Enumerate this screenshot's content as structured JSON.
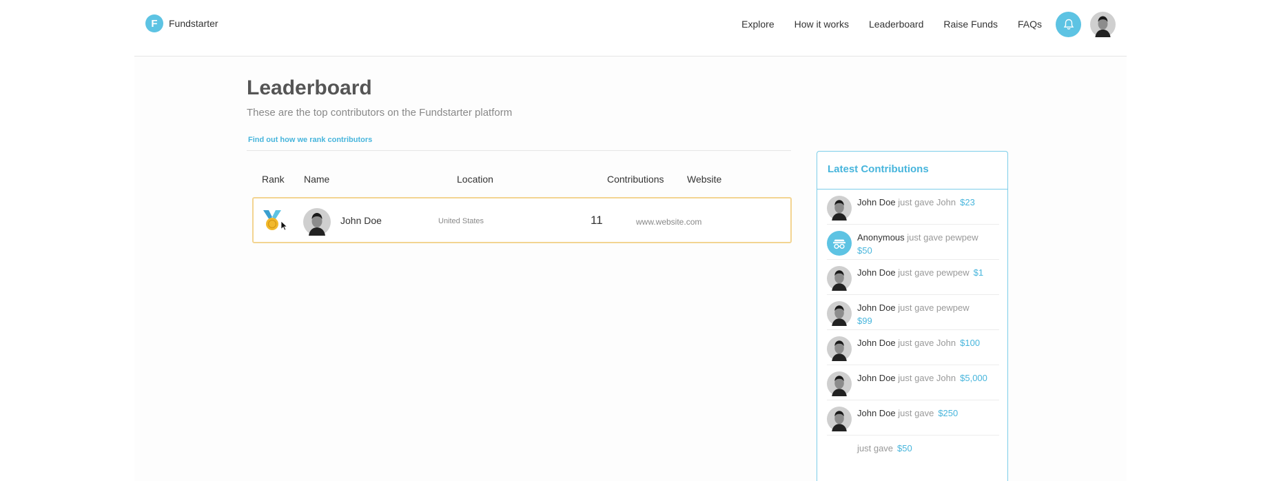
{
  "brand": {
    "logo_letter": "F",
    "name": "Fundstarter"
  },
  "nav": {
    "links": [
      "Explore",
      "How it works",
      "Leaderboard",
      "Raise Funds",
      "FAQs"
    ]
  },
  "page": {
    "title": "Leaderboard",
    "subtitle": "These are the top contributors on the Fundstarter platform",
    "rank_link": "Find out how we rank contributors"
  },
  "table": {
    "headers": {
      "rank": "Rank",
      "name": "Name",
      "location": "Location",
      "contributions": "Contributions",
      "website": "Website"
    },
    "rows": [
      {
        "rank_icon": "gold-medal-icon",
        "name": "John Doe",
        "location": "United States",
        "contributions": "11",
        "website": "www.website.com"
      }
    ]
  },
  "feed": {
    "title": "Latest Contributions",
    "items": [
      {
        "name": "John Doe",
        "action": "just gave John",
        "amount": "$23",
        "avatar": "user-photo"
      },
      {
        "name": "Anonymous",
        "action": "just gave pewpew",
        "amount": "$50",
        "avatar": "anonymous-icon"
      },
      {
        "name": "John Doe",
        "action": "just gave pewpew",
        "amount": "$1",
        "avatar": "user-photo"
      },
      {
        "name": "John Doe",
        "action": "just gave pewpew",
        "amount": "$99",
        "avatar": "user-photo"
      },
      {
        "name": "John Doe",
        "action": "just gave John",
        "amount": "$100",
        "avatar": "user-photo"
      },
      {
        "name": "John Doe",
        "action": "just gave John",
        "amount": "$5,000",
        "avatar": "user-photo"
      },
      {
        "name": "John Doe",
        "action": "just gave",
        "amount": "$250",
        "avatar": "user-photo"
      },
      {
        "name": "",
        "action": "just gave",
        "amount": "$50",
        "avatar": ""
      }
    ]
  },
  "colors": {
    "accent": "#5dc3e3",
    "link": "#47b5dc",
    "row_highlight": "#f3d491",
    "medal_gold": "#f2b92c"
  }
}
